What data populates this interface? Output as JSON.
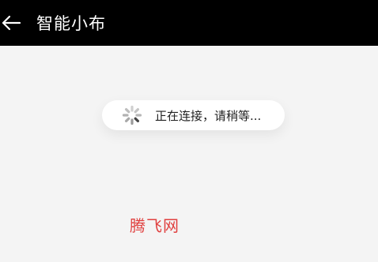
{
  "header": {
    "title": "智能小布",
    "back_icon": "arrow-left-icon",
    "background": "#000000",
    "text_color": "#ffffff"
  },
  "toast": {
    "message": "正在连接，请稍等...",
    "spinner_icon": "loading-spinner-icon"
  },
  "watermark": {
    "text": "腾飞网",
    "color": "#e0403f"
  }
}
